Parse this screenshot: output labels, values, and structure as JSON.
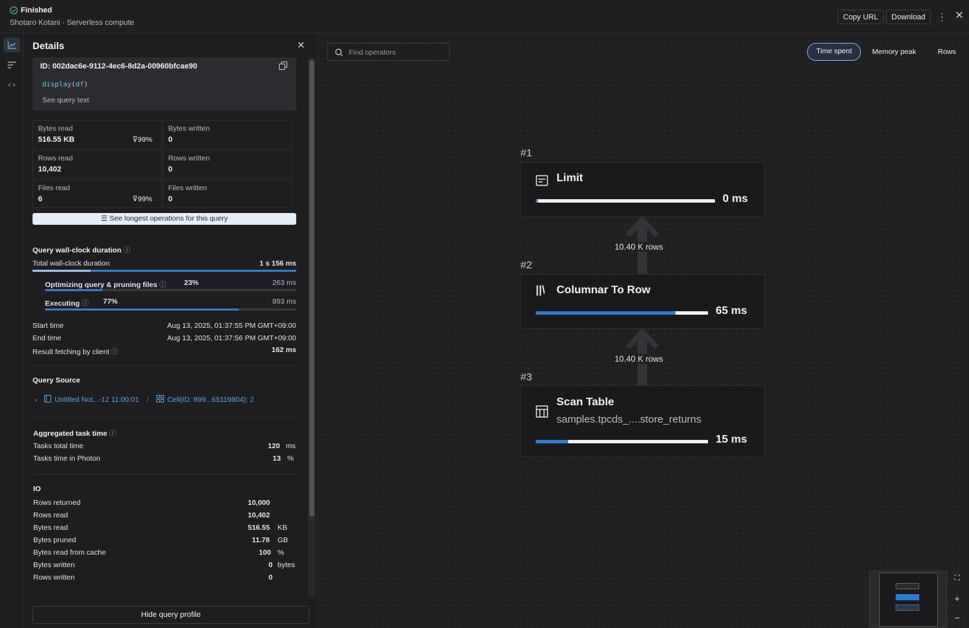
{
  "header": {
    "status": "Finished",
    "subtitle": "Shotaro Kotani · Serverless compute",
    "copy_url": "Copy URL",
    "download": "Download"
  },
  "details": {
    "title": "Details",
    "query_id": "ID: 002dac6e-9112-4ec6-8d2a-00960bfcae90",
    "code_fn": "display",
    "code_arg": "df",
    "see_query_text": "See query text",
    "metrics": [
      {
        "label": "Bytes read",
        "value": "516.55 KB",
        "badge": "99%"
      },
      {
        "label": "Bytes written",
        "value": "0"
      },
      {
        "label": "Rows read",
        "value": "10,402"
      },
      {
        "label": "Rows written",
        "value": "0"
      },
      {
        "label": "Files read",
        "value": "6",
        "badge": "99%"
      },
      {
        "label": "Files written",
        "value": "0"
      }
    ],
    "longest_ops": "See longest operations for this query",
    "wallclock": {
      "title": "Query wall-clock duration",
      "total_label": "Total wall-clock duration",
      "total_value": "1 s 156 ms",
      "opt_label": "Optimizing query & pruning files",
      "opt_pct": "23%",
      "opt_value": "263 ms",
      "opt_fraction": 0.23,
      "exec_label": "Executing",
      "exec_pct": "77%",
      "exec_value": "893 ms",
      "exec_fraction": 0.77
    },
    "times": [
      {
        "label": "Start time",
        "value": "Aug 13, 2025, 01:37:55 PM GMT+09:00"
      },
      {
        "label": "End time",
        "value": "Aug 13, 2025, 01:37:56 PM GMT+09:00"
      },
      {
        "label": "Result fetching by client",
        "value": "162 ms"
      }
    ],
    "source": {
      "title": "Query Source",
      "notebook": "Untitled Not...-12 11:00:01",
      "cell": "Cell(ID: 899...65119804): 2"
    },
    "task": {
      "title": "Aggregated task time",
      "rows": [
        {
          "label": "Tasks total time",
          "value": "120",
          "unit": "ms"
        },
        {
          "label": "Tasks time in Photon",
          "value": "13",
          "unit": "%"
        }
      ]
    },
    "io": {
      "title": "IO",
      "rows": [
        {
          "label": "Rows returned",
          "value": "10,000",
          "unit": ""
        },
        {
          "label": "Rows read",
          "value": "10,402",
          "unit": ""
        },
        {
          "label": "Bytes read",
          "value": "516.55",
          "unit": "KB"
        },
        {
          "label": "Bytes pruned",
          "value": "11.78",
          "unit": "GB"
        },
        {
          "label": "Bytes read from cache",
          "value": "100",
          "unit": "%"
        },
        {
          "label": "Bytes written",
          "value": "0",
          "unit": "bytes"
        },
        {
          "label": "Rows written",
          "value": "0",
          "unit": ""
        }
      ]
    },
    "hide_profile": "Hide query profile"
  },
  "canvas": {
    "search_placeholder": "Find operators",
    "toggles": [
      "Time spent",
      "Memory peak",
      "Rows"
    ],
    "nodes": [
      {
        "id": "#1",
        "name": "Limit",
        "sub": "",
        "time": "0 ms",
        "fraction": 0.01
      },
      {
        "id": "#2",
        "name": "Columnar To Row",
        "sub": "",
        "time": "65 ms",
        "fraction": 0.81
      },
      {
        "id": "#3",
        "name": "Scan Table",
        "sub": "samples.tpcds_....store_returns",
        "time": "15 ms",
        "fraction": 0.19
      }
    ],
    "edges": [
      "10.40 K rows",
      "10.40 K rows"
    ]
  },
  "colors": {
    "accent": "#2f7ad0",
    "link": "#5aa2ef",
    "success": "#4fbf7a"
  }
}
